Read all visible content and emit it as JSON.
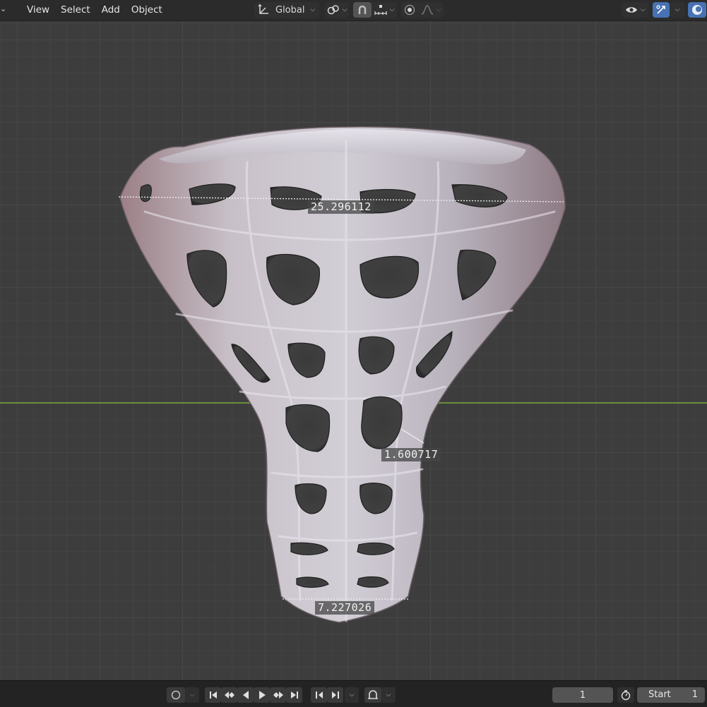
{
  "header": {
    "menus": [
      "View",
      "Select",
      "Add",
      "Object"
    ],
    "transform_orientation": "Global",
    "icons": {
      "orientation": "axis-gizmo-icon",
      "pivot": "link-icon",
      "snap": "magnet-icon",
      "snap_target": "snap-increment-icon",
      "proportional": "proportional-edit-icon",
      "falloff": "falloff-curve-icon",
      "visibility": "eye-icon",
      "gizmo": "gizmo-icon",
      "overlay": "overlay-icon"
    }
  },
  "viewport": {
    "measurements": [
      {
        "name": "top-width",
        "value": "25.296112"
      },
      {
        "name": "wall-thickness",
        "value": "1.600717"
      },
      {
        "name": "bottom-width",
        "value": "7.227026"
      }
    ],
    "colors": {
      "axis_x": "#6a8f3b",
      "grid": "#474747",
      "background": "#3d3d3d"
    }
  },
  "timeline": {
    "current_frame": "1",
    "start_label": "Start",
    "start_value": "1",
    "icons": [
      "record-icon",
      "jump-start-icon",
      "prev-keyframe-icon",
      "play-reverse-icon",
      "play-icon",
      "next-keyframe-icon",
      "jump-end-icon",
      "prev-marker-icon",
      "next-marker-icon",
      "keying-icon",
      "stopwatch-icon"
    ]
  }
}
